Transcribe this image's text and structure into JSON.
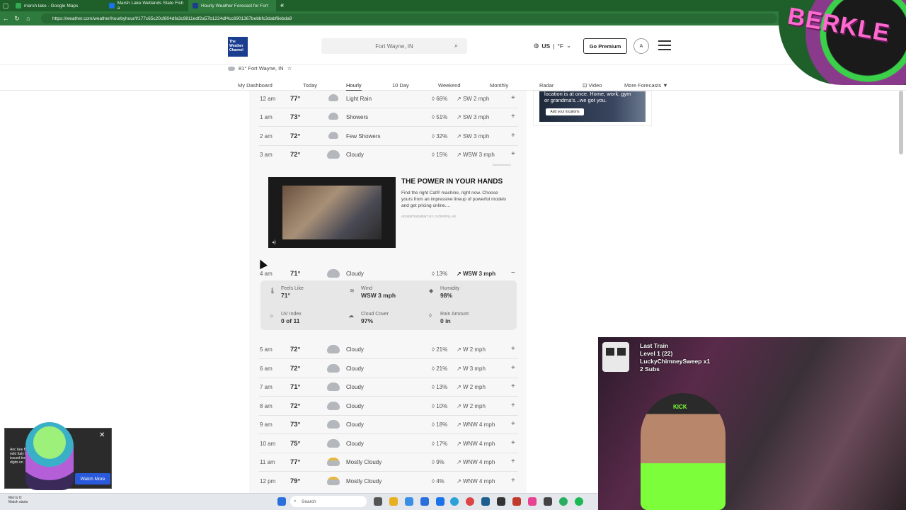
{
  "browser": {
    "tabs": [
      {
        "title": "marsh lake - Google Maps",
        "color": "#34a853",
        "active": false
      },
      {
        "title": "Marsh Lake Wetlands State Fish a",
        "color": "#1a73e8",
        "active": false
      },
      {
        "title": "Hourly Weather Forecast for Fort",
        "color": "#1b3d8f",
        "active": true
      }
    ],
    "url": "https://weather.com/weather/hourbyhour/l/177c65c20cf804dfa3c9811edf2a57b1224df4cc6901367bebbfc3dabf6ebda9"
  },
  "header": {
    "logo_lines": [
      "The",
      "Weather",
      "Channel"
    ],
    "search_placeholder": "Fort Wayne, IN",
    "region": "US",
    "unit": "°F",
    "premium_label": "Go Premium",
    "account_initial": "A",
    "location": "81° Fort Wayne, IN"
  },
  "subnav": [
    {
      "label": "My Dashboard",
      "active": false
    },
    {
      "label": "Today",
      "active": false
    },
    {
      "label": "Hourly",
      "active": true
    },
    {
      "label": "10 Day",
      "active": false
    },
    {
      "label": "Weekend",
      "active": false
    },
    {
      "label": "Monthly",
      "active": false
    },
    {
      "label": "Radar",
      "active": false
    },
    {
      "label": "Video",
      "active": false
    },
    {
      "label": "More Forecasts",
      "active": false
    }
  ],
  "hourly_top": [
    {
      "time": "12 am",
      "temp": "77°",
      "cond": "Light Rain",
      "icon": "shower",
      "rain": "66%",
      "wind": "SW 2 mph"
    },
    {
      "time": "1 am",
      "temp": "73°",
      "cond": "Showers",
      "icon": "shower",
      "rain": "51%",
      "wind": "SW 3 mph"
    },
    {
      "time": "2 am",
      "temp": "72°",
      "cond": "Few Showers",
      "icon": "shower",
      "rain": "32%",
      "wind": "SW 3 mph"
    },
    {
      "time": "3 am",
      "temp": "72°",
      "cond": "Cloudy",
      "icon": "cloud",
      "rain": "15%",
      "wind": "WSW 3 mph"
    }
  ],
  "ad": {
    "label": "Advertisement",
    "title": "THE POWER IN YOUR HANDS",
    "body": "Find the right Cat® machine, right now. Choose yours from an impressive lineup of powerful models and get pricing online....",
    "sponsor": "ADVERTISEMENT BY CATERPILLAR"
  },
  "expanded_row": {
    "time": "4 am",
    "temp": "71°",
    "cond": "Cloudy",
    "rain": "13%",
    "wind": "WSW 3 mph"
  },
  "details": {
    "feels_like_label": "Feels Like",
    "feels_like": "71°",
    "wind_label": "Wind",
    "wind": "WSW 3 mph",
    "humidity_label": "Humidity",
    "humidity": "98%",
    "uv_label": "UV Index",
    "uv": "0 of 11",
    "cloud_label": "Cloud Cover",
    "cloud": "97%",
    "rain_amount_label": "Rain Amount",
    "rain_amount": "0 in"
  },
  "hourly_bottom": [
    {
      "time": "5 am",
      "temp": "72°",
      "cond": "Cloudy",
      "icon": "cloud",
      "rain": "21%",
      "wind": "W 2 mph"
    },
    {
      "time": "6 am",
      "temp": "72°",
      "cond": "Cloudy",
      "icon": "cloud",
      "rain": "21%",
      "wind": "W 3 mph"
    },
    {
      "time": "7 am",
      "temp": "71°",
      "cond": "Cloudy",
      "icon": "cloud",
      "rain": "13%",
      "wind": "W 2 mph"
    },
    {
      "time": "8 am",
      "temp": "72°",
      "cond": "Cloudy",
      "icon": "cloud",
      "rain": "10%",
      "wind": "W 2 mph"
    },
    {
      "time": "9 am",
      "temp": "73°",
      "cond": "Cloudy",
      "icon": "cloud",
      "rain": "18%",
      "wind": "WNW 4 mph"
    },
    {
      "time": "10 am",
      "temp": "75°",
      "cond": "Cloudy",
      "icon": "cloud",
      "rain": "17%",
      "wind": "WNW 4 mph"
    },
    {
      "time": "11 am",
      "temp": "77°",
      "cond": "Mostly Cloudy",
      "icon": "sun",
      "rain": "9%",
      "wind": "WNW 4 mph"
    },
    {
      "time": "12 pm",
      "temp": "79°",
      "cond": "Mostly Cloudy",
      "icon": "sun",
      "rain": "4%",
      "wind": "WNW 4 mph"
    }
  ],
  "right_ad": {
    "text": "location is at once. Home, work, gym or grandma's...we got you.",
    "button": "Add your locations"
  },
  "stream": {
    "title": "Last Train",
    "level": "Level 1  (22)",
    "user": "LuckyChimneySweep x1",
    "subs": "2 Subs",
    "hat_text": "KICK",
    "overlay_brand": "BERKLE",
    "widget_button": "Watch More",
    "widget_text": "Anc bee Bel mild Italy M issued temp digits on"
  },
  "taskbar": {
    "search": "Search",
    "news_line1": "Men's O",
    "news_line2": "Match starts"
  }
}
